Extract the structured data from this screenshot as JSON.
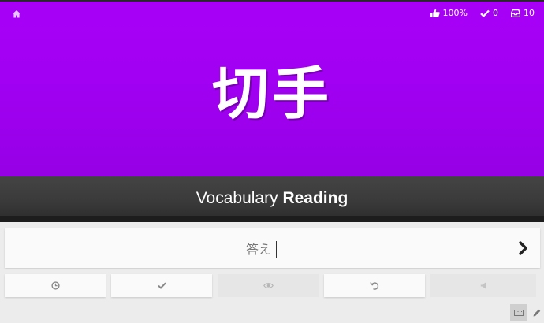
{
  "header": {
    "stats": {
      "accuracy": "100%",
      "correct": "0",
      "remaining": "10"
    }
  },
  "item": {
    "characters": "切手",
    "type_label": "Vocabulary",
    "question_label": "Reading"
  },
  "answer": {
    "placeholder": "答え",
    "value": ""
  },
  "colors": {
    "vocabulary_bg": "#a100f2",
    "band_bg": "#3a3a3a"
  },
  "icons": {
    "home": "home-icon",
    "accuracy": "thumbs-up-icon",
    "correct": "checkmark-icon",
    "remaining": "inbox-icon",
    "submit": "chevron-right-icon",
    "buttons": [
      "clock-icon",
      "check-icon",
      "eye-icon",
      "undo-icon",
      "volume-icon"
    ],
    "keyboard": "keyboard-icon",
    "pencil": "pencil-icon"
  }
}
